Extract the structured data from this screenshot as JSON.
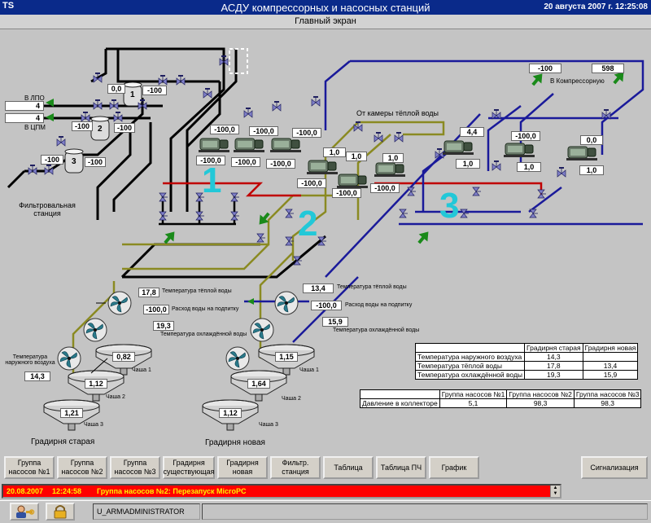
{
  "window": {
    "logo": "TS",
    "title": "АСДУ компрессорных и насосных станций",
    "datetime": "20 августа 2007 г.  12:25:08",
    "screen_title": "Главный экран"
  },
  "labels": {
    "lpo": "В ЛПО",
    "cpm": "В ЦПМ",
    "filter_station": "Фильтровальная станция",
    "from_chamber": "От камеры тёплой воды",
    "to_compressor": "В Компрессорную",
    "cooling_old": "Градирня старая",
    "cooling_new": "Градирня новая",
    "outdoor_temp": "Температура наружного воздуха",
    "warm_temp": "Температура тёплой воды",
    "flow": "Расход воды на подпитку",
    "cooled_temp": "Температура охлаждённой воды",
    "bowl1": "Чаша 1",
    "bowl2": "Чаша 2",
    "bowl3": "Чаша 3",
    "group1": "1",
    "group2": "2",
    "group3": "3",
    "tank1": "1",
    "tank2": "2",
    "tank3": "3"
  },
  "values": {
    "lpo_out": "4",
    "cpm_out": "4",
    "tank1_level": "0,0",
    "tank1_p": "-100",
    "tank2_level": "-100",
    "tank2_p": "-100",
    "tank3_level": "-100",
    "tank3_p": "-100",
    "g1_p1": "-100,0",
    "g1_p2": "-100,0",
    "g1_p3": "-100,0",
    "g1_b1": "-100,0",
    "g1_b2": "-100,0",
    "g1_b3": "-100,0",
    "g2_a1": "1,0",
    "g2_a2": "1,0",
    "g2_a3": "1,0",
    "g2_b1": "-100,0",
    "g2_b2": "-100,0",
    "g2_b3": "-100,0",
    "g3_a1": "4,4",
    "g3_a2": "-100,0",
    "g3_a3": "0,0",
    "g3_b1": "1,0",
    "g3_b2": "1,0",
    "g3_b3": "1,0",
    "comp_left": "-100",
    "comp_right": "598",
    "old_warm": "17,8",
    "old_flow": "-100,0",
    "old_cooled": "19,3",
    "outdoor": "14,3",
    "old_bowl1": "0,82",
    "old_bowl2": "1,12",
    "old_bowl3": "1,21",
    "new_warm": "13,4",
    "new_flow": "-100,0",
    "new_cooled": "15,9",
    "new_bowl1": "1,15",
    "new_bowl2": "1,64",
    "new_bowl3": "1,12"
  },
  "cooling_table": {
    "headers": [
      "",
      "Градирня старая",
      "Градирня новая"
    ],
    "rows": [
      [
        "Температура наружного воздуха",
        "14,3",
        ""
      ],
      [
        "Температура тёплой воды",
        "17,8",
        "13,4"
      ],
      [
        "Температура охлаждённой воды",
        "19,3",
        "15,9"
      ]
    ]
  },
  "pressure_table": {
    "headers": [
      "",
      "Группа насосов №1",
      "Группа насосов №2",
      "Группа насосов №3"
    ],
    "rows": [
      [
        "Давление в коллекторе",
        "5,1",
        "98,3",
        "98,3"
      ]
    ]
  },
  "toolbar": {
    "buttons": [
      "Группа насосов №1",
      "Группа насосов №2",
      "Группа насосов №3",
      "Градирня существующая",
      "Градирня новая",
      "Фильтр. станция",
      "Таблица",
      "Таблица ПЧ",
      "График"
    ],
    "alarm_button": "Сигнализация"
  },
  "alarm": {
    "date": "20.08.2007",
    "time": "12:24:58",
    "message": "Группа насосов №2: Перезапуск MicroPC",
    "color": "#ff0000"
  },
  "status": {
    "user": "U_ARM\\ADMINISTRATOR",
    "icons": [
      "user-key-icon",
      "lock-icon"
    ]
  },
  "colors": {
    "pipe_warm": "#8a8a22",
    "pipe_red": "#c00000",
    "pipe_blue": "#1a1a9a",
    "pipe_black": "#000000",
    "arrow": "#1a8a1a",
    "big_number": "#22c8d8"
  }
}
